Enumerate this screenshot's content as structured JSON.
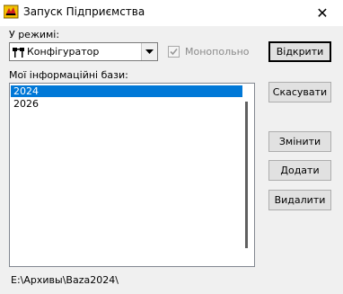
{
  "window": {
    "title": "Запуск Підприємства",
    "close_icon": "close-icon",
    "app_icon": "1c-enterprise-icon"
  },
  "mode": {
    "label": "У режимі:",
    "selected": "Конфігуратор",
    "selected_icon": "configurator-icon"
  },
  "monopoly": {
    "label": "Монопольно",
    "checked": true,
    "enabled": false
  },
  "bases": {
    "label": "Мої інформаційні бази:",
    "items": [
      "2024",
      "2026"
    ],
    "selected_index": 0
  },
  "buttons": {
    "open": "Відкрити",
    "cancel": "Скасувати",
    "edit": "Змінити",
    "add": "Додати",
    "delete": "Видалити"
  },
  "status_path": "E:\\Архивы\\Baza2024\\",
  "colors": {
    "selection": "#0078d7",
    "window_bg": "#f0f0f0"
  }
}
